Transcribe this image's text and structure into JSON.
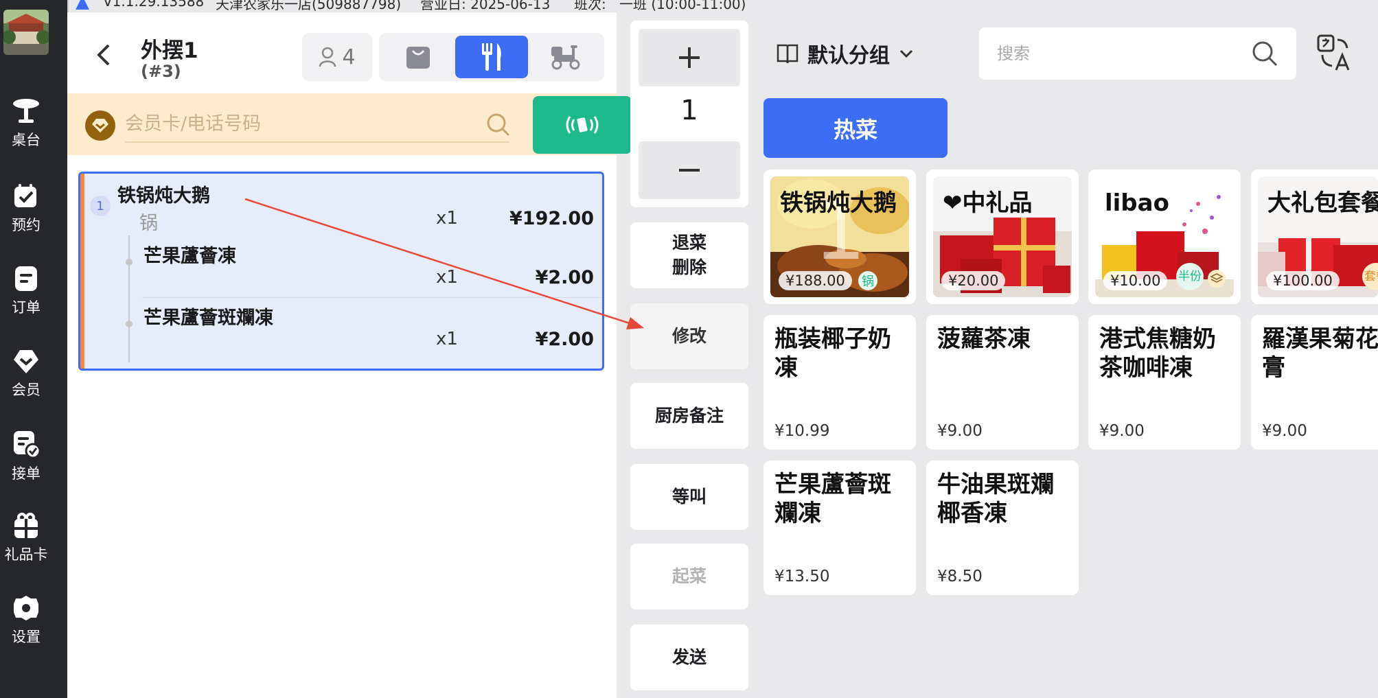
{
  "status_bar": {
    "version": "V1.1.29.13588",
    "store": "天津农家乐一店(509887798)",
    "business_day": "营业日: 2025-06-13",
    "shift_label": "班次:",
    "shift": "一班 (10:00-11:00)"
  },
  "sidebar": {
    "items": [
      {
        "label": "桌台",
        "icon": "table-icon"
      },
      {
        "label": "预约",
        "icon": "reservation-icon"
      },
      {
        "label": "订单",
        "icon": "order-icon"
      },
      {
        "label": "会员",
        "icon": "member-icon"
      },
      {
        "label": "接单",
        "icon": "accept-order-icon"
      },
      {
        "label": "礼品卡",
        "icon": "gift-card-icon"
      },
      {
        "label": "设置",
        "icon": "gear-icon"
      }
    ]
  },
  "order": {
    "table_name": "外摆1",
    "order_no": "(#3)",
    "guests": "4",
    "member_placeholder": "会员卡/电话号码",
    "items": [
      {
        "index": "1",
        "name": "铁锅炖大鹅",
        "unit": "锅",
        "qty": "x1",
        "price": "¥192.00"
      },
      {
        "name": "芒果蘆薈凍",
        "qty": "x1",
        "price": "¥2.00"
      },
      {
        "name": "芒果蘆薈斑斕凍",
        "qty": "x1",
        "price": "¥2.00"
      }
    ]
  },
  "actions": {
    "qty_value": "1",
    "return_delete": [
      "退菜",
      "删除"
    ],
    "modify": "修改",
    "kitchen_note": "厨房备注",
    "wait_call": "等叫",
    "start_dish": "起菜",
    "send": "发送"
  },
  "menu": {
    "group": "默认分组",
    "search_placeholder": "搜索",
    "category": "热菜",
    "photo_dishes": [
      {
        "title": "铁锅炖大鹅",
        "price": "¥188.00",
        "tag": "锅"
      },
      {
        "title": "❤中礼品",
        "price": "¥20.00",
        "tag": ""
      },
      {
        "title": "libao",
        "price": "¥10.00",
        "tag": "半份"
      },
      {
        "title": "大礼包套餐",
        "price": "¥100.00",
        "tag": "套餐"
      }
    ],
    "text_dishes": [
      {
        "title": "瓶装椰子奶凍",
        "price": "¥10.99"
      },
      {
        "title": "菠蘿茶凍",
        "price": "¥9.00"
      },
      {
        "title": "港式焦糖奶茶咖啡凍",
        "price": "¥9.00"
      },
      {
        "title": "羅漢果菊花茯苓膏",
        "price": "¥9.00"
      },
      {
        "title": "芒果蘆薈斑斕凍",
        "price": "¥13.50"
      },
      {
        "title": "牛油果斑斕椰香凍",
        "price": "¥8.50"
      }
    ]
  },
  "colors": {
    "sidebar_bg": "#26272b",
    "accent_blue": "#3d6cf5",
    "accent_green": "#1eb98b",
    "member_bar": "#fcebcc",
    "arrow_red": "#e8483a"
  }
}
